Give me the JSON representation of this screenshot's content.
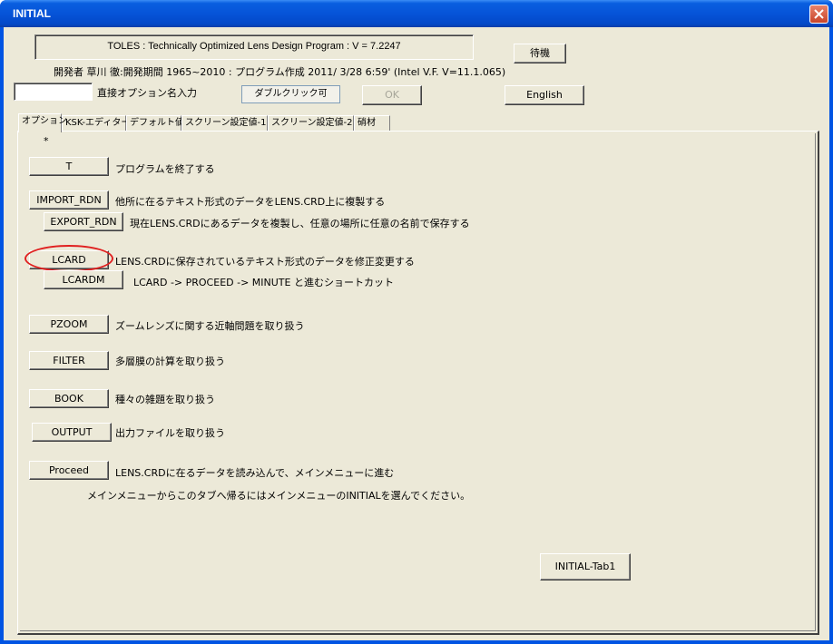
{
  "window": {
    "title": "INITIAL"
  },
  "header": {
    "program_title": "TOLES : Technically Optimized Lens Design Program : V =  7.2247",
    "wait_button": "待機",
    "developer_line": "開発者 草川  徹:開発期間 1965~2010 : プログラム作成  2011/ 3/28   6:59' (Intel V.F. V=11.1.065)",
    "direct_option_input_value": "",
    "direct_option_label": "直接オプション名入力",
    "double_click_button": "ダブルクリック可",
    "ok_button": "OK",
    "english_button": "English"
  },
  "tabs": [
    {
      "label": "オプション",
      "active": true
    },
    {
      "label": "KSK-エディター",
      "active": false
    },
    {
      "label": "デフォルト値",
      "active": false
    },
    {
      "label": "スクリーン設定値-1",
      "active": false
    },
    {
      "label": "スクリーン設定値-2",
      "active": false
    },
    {
      "label": "硝材",
      "active": false
    }
  ],
  "panel": {
    "asterisk": "*",
    "commands": [
      {
        "button": "T",
        "description": "プログラムを終了する"
      },
      {
        "button": "IMPORT_RDN",
        "description": "他所に在るテキスト形式のデータをLENS.CRD上に複製する"
      },
      {
        "button": "EXPORT_RDN",
        "description": "現在LENS.CRDにあるデータを複製し、任意の場所に任意の名前で保存する"
      },
      {
        "button": "LCARD",
        "description": "LENS.CRDに保存されているテキスト形式のデータを修正変更する"
      },
      {
        "button": "LCARDM",
        "description": "LCARD -> PROCEED -> MINUTE  と進むショートカット"
      },
      {
        "button": "PZOOM",
        "description": "ズームレンズに関する近軸問題を取り扱う"
      },
      {
        "button": "FILTER",
        "description": "多層膜の計算を取り扱う"
      },
      {
        "button": "BOOK",
        "description": "種々の雑題を取り扱う"
      },
      {
        "button": "OUTPUT",
        "description": "出力ファイルを取り扱う"
      },
      {
        "button": "Proceed",
        "description": "LENS.CRDに在るデータを読み込んで、メインメニューに進む"
      }
    ],
    "note": "メインメニューからこのタブへ帰るにはメインメニューのINITIALを選んでください。",
    "tab_id_button": "INITIAL-Tab1"
  },
  "colors": {
    "titlebar": "#0054e3",
    "face": "#ece9d8",
    "highlight_circle": "#e02020"
  }
}
